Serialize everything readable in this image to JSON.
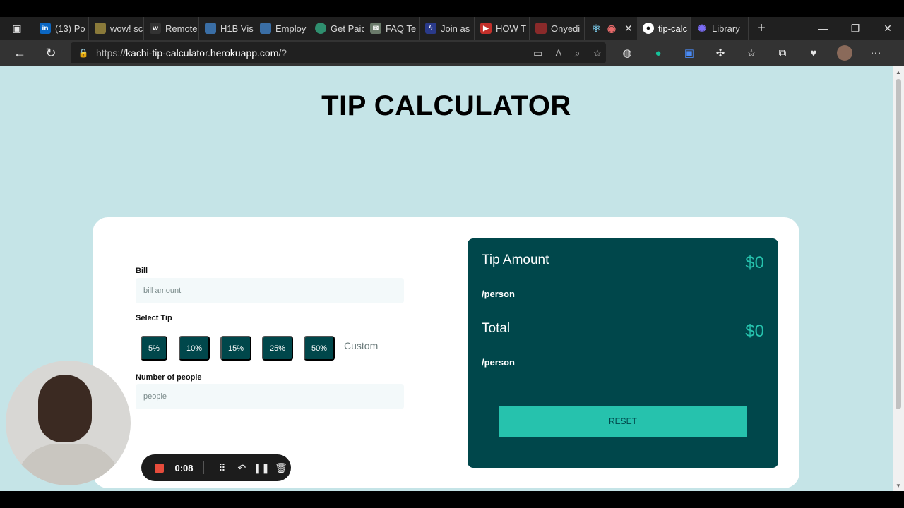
{
  "browser": {
    "tabs": [
      {
        "label": "(13) Po",
        "icon": "linkedin-icon",
        "color": "#0a66c2"
      },
      {
        "label": "wow! sc",
        "icon": "doge-icon",
        "color": "#8a7a3a"
      },
      {
        "label": "Remote",
        "icon": "wwr-icon",
        "color": "#333333"
      },
      {
        "label": "H1B Vis",
        "icon": "shield-icon",
        "color": "#3a6ea5"
      },
      {
        "label": "Employ",
        "icon": "shield-icon",
        "color": "#3a6ea5"
      },
      {
        "label": "Get Paid",
        "icon": "leaf-icon",
        "color": "#2f8f6f"
      },
      {
        "label": "FAQ Te",
        "icon": "mail-icon",
        "color": "#6a7a6a"
      },
      {
        "label": "Join as",
        "icon": "bolt-icon",
        "color": "#2a3a8a"
      },
      {
        "label": "HOW T",
        "icon": "youtube-icon",
        "color": "#c4302b"
      },
      {
        "label": "Onyedi",
        "icon": "pdf-icon",
        "color": "#8a2a2a"
      }
    ],
    "active_tab": {
      "label": "tip-calc",
      "icon": "github-icon"
    },
    "last_tab": {
      "label": "Library",
      "icon": "library-icon"
    },
    "url_prefix": "https://",
    "url_host": "kachi-tip-calculator.herokuapp.com",
    "url_path": "/?"
  },
  "page": {
    "title": "TIP CALCULATOR",
    "bill": {
      "label": "Bill",
      "placeholder": "bill amount"
    },
    "select_tip": {
      "label": "Select Tip",
      "options": [
        "5%",
        "10%",
        "15%",
        "25%",
        "50%"
      ],
      "custom_label": "Custom"
    },
    "people": {
      "label": "Number of people",
      "placeholder": "people"
    },
    "results": {
      "tip_label": "Tip Amount",
      "tip_sub": "/person",
      "tip_value": "$0",
      "total_label": "Total",
      "total_sub": "/person",
      "total_value": "$0",
      "reset_label": "RESET"
    },
    "colors": {
      "accent": "#26c2ad",
      "dark": "#00474b",
      "background": "#c5e4e7"
    }
  },
  "recorder": {
    "time": "0:08"
  }
}
